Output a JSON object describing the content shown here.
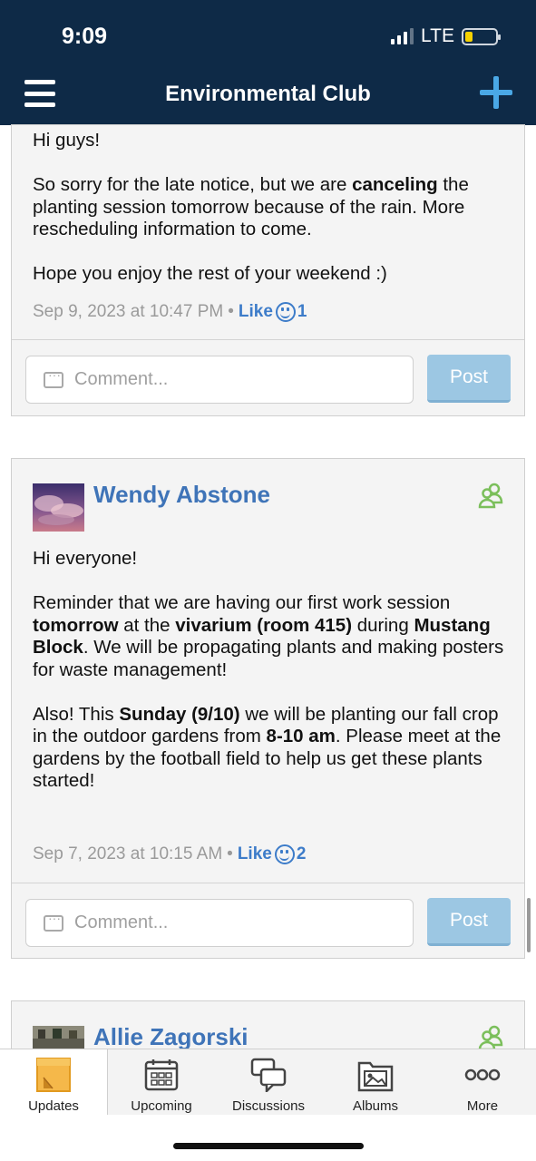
{
  "status_bar": {
    "time": "9:09",
    "network": "LTE"
  },
  "header": {
    "title": "Environmental Club"
  },
  "posts": [
    {
      "paragraphs": [
        {
          "segments": [
            {
              "text": "Hi guys!"
            }
          ]
        },
        {
          "segments": [
            {
              "text": "So sorry for the late notice, but we are "
            },
            {
              "text": "canceling",
              "bold": true
            },
            {
              "text": " the planting session tomorrow because of the rain. More rescheduling information to come."
            }
          ]
        },
        {
          "segments": [
            {
              "text": "Hope you enjoy the rest of your weekend :)"
            }
          ]
        }
      ],
      "timestamp": "Sep 9, 2023 at 10:47 PM",
      "like_label": "Like",
      "like_count": "1",
      "comment_placeholder": "Comment...",
      "post_label": "Post"
    },
    {
      "author": "Wendy Abstone",
      "paragraphs": [
        {
          "segments": [
            {
              "text": "Hi everyone!"
            }
          ]
        },
        {
          "segments": [
            {
              "text": "Reminder that we are having our first work session "
            },
            {
              "text": "tomorrow",
              "bold": true
            },
            {
              "text": " at the "
            },
            {
              "text": "vivarium (room 415)",
              "bold": true
            },
            {
              "text": " during "
            },
            {
              "text": "Mustang Block",
              "bold": true
            },
            {
              "text": ". We will be propagating plants and making posters for waste management!"
            }
          ]
        },
        {
          "segments": [
            {
              "text": "Also! This "
            },
            {
              "text": "Sunday (9/10)",
              "bold": true
            },
            {
              "text": " we will be planting our fall crop in the outdoor gardens from "
            },
            {
              "text": "8-10 am",
              "bold": true
            },
            {
              "text": ". Please meet at the gardens by the football field to help us get these plants started!"
            }
          ]
        }
      ],
      "timestamp": "Sep 7, 2023 at 10:15 AM",
      "like_label": "Like",
      "like_count": "2",
      "comment_placeholder": "Comment...",
      "post_label": "Post"
    },
    {
      "author": "Allie Zagorski"
    }
  ],
  "tabs": [
    {
      "label": "Updates",
      "icon": "sticky-note-icon",
      "active": true
    },
    {
      "label": "Upcoming",
      "icon": "calendar-icon"
    },
    {
      "label": "Discussions",
      "icon": "chat-bubbles-icon"
    },
    {
      "label": "Albums",
      "icon": "photo-album-icon"
    },
    {
      "label": "More",
      "icon": "more-dots-icon"
    }
  ],
  "colors": {
    "header_bg": "#0e2a47",
    "accent_blue": "#3d7cc9",
    "plus_blue": "#4aa8e6",
    "post_button": "#9cc7e3",
    "member_green": "#7bbf5b"
  }
}
